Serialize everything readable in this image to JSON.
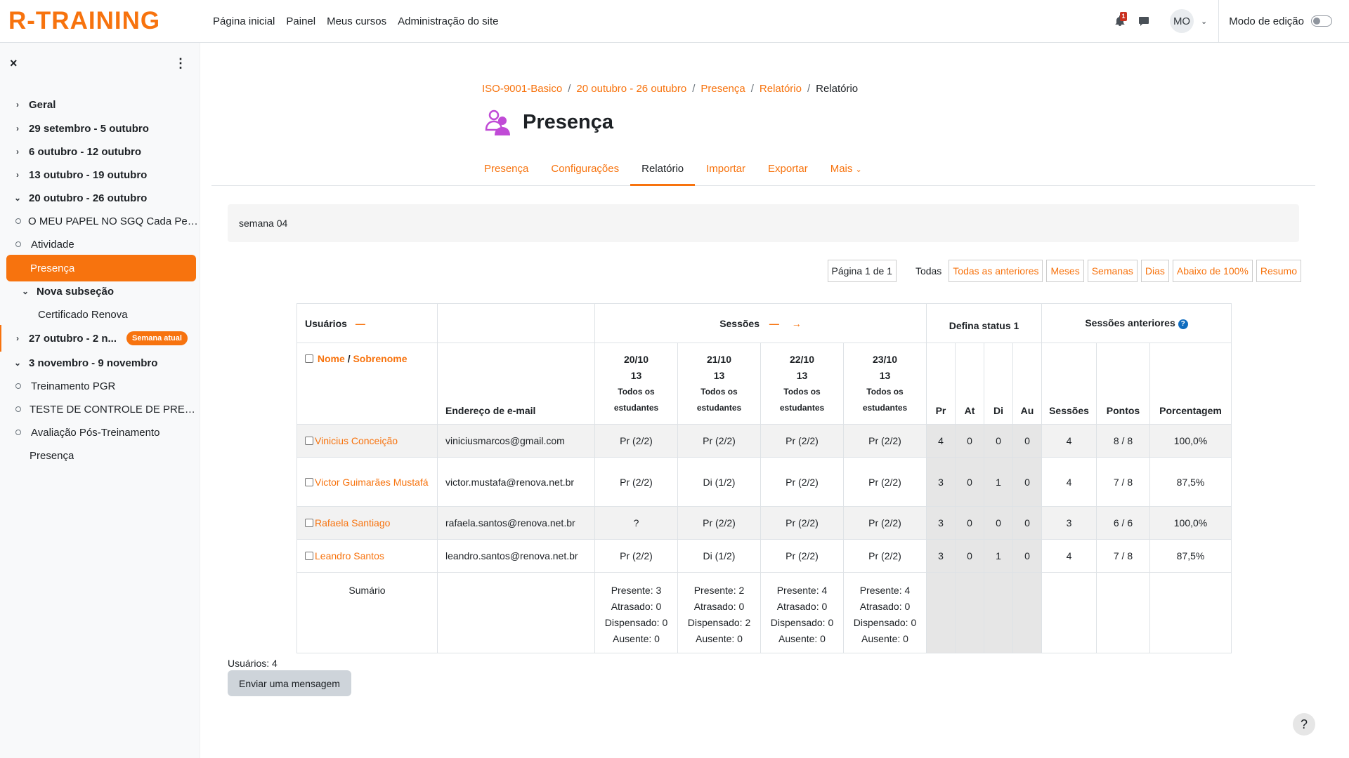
{
  "brand": {
    "logo_text": "R-TRAINING",
    "accent_color": "#f7730e"
  },
  "navbar": {
    "items": [
      "Página inicial",
      "Painel",
      "Meus cursos",
      "Administração do site"
    ],
    "notification_count": "1",
    "avatar_initials": "MO",
    "edit_mode_label": "Modo de edição"
  },
  "drawer": {
    "close_icon": "×",
    "menu_icon": "⋮",
    "items": [
      {
        "label": "Geral"
      },
      {
        "label": "29 setembro - 5 outubro"
      },
      {
        "label": "6 outubro - 12 outubro"
      },
      {
        "label": "13 outubro - 19 outubro"
      },
      {
        "label": "20 outubro - 26 outubro"
      },
      {
        "label": "O MEU PAPEL NO SGQ Cada Pes..."
      },
      {
        "label": "Atividade"
      },
      {
        "label": "Presença"
      },
      {
        "label": "Nova subseção"
      },
      {
        "label": "Certificado Renova"
      },
      {
        "label": "27 outubro - 2 n...",
        "badge": "Semana atual"
      },
      {
        "label": "3 novembro - 9 novembro"
      },
      {
        "label": "Treinamento PGR"
      },
      {
        "label": "TESTE DE CONTROLE DE PRESE..."
      },
      {
        "label": "Avaliação Pós-Treinamento"
      },
      {
        "label": "Presença"
      }
    ]
  },
  "breadcrumb": [
    "ISO-9001-Basico",
    "20 outubro - 26 outubro",
    "Presença",
    "Relatório",
    "Relatório"
  ],
  "page_title": "Presença",
  "tabs": [
    "Presença",
    "Configurações",
    "Relatório",
    "Importar",
    "Exportar",
    "Mais"
  ],
  "description": "semana 04",
  "filters": {
    "page_label": "Página 1 de 1",
    "todas": "Todas",
    "buttons": [
      "Todas as anteriores",
      "Meses",
      "Semanas",
      "Dias",
      "Abaixo de 100%",
      "Resumo"
    ]
  },
  "table": {
    "users_header": "Usuários",
    "sessions_header": "Sessões",
    "status_header": "Defina status 1",
    "previous_header": "Sessões anteriores",
    "name_label": "Nome",
    "surname_label": "Sobrenome",
    "slash": "/",
    "email_header": "Endereço de e-mail",
    "sessions": [
      {
        "date": "20/10",
        "time": "13",
        "group": "Todos os",
        "group2": "estudantes"
      },
      {
        "date": "21/10",
        "time": "13",
        "group": "Todos os",
        "group2": "estudantes"
      },
      {
        "date": "22/10",
        "time": "13",
        "group": "Todos os",
        "group2": "estudantes"
      },
      {
        "date": "23/10",
        "time": "13",
        "group": "Todos os",
        "group2": "estudantes"
      }
    ],
    "status_cols": [
      "Pr",
      "At",
      "Di",
      "Au"
    ],
    "prev_cols": [
      "Sessões",
      "Pontos",
      "Porcentagem"
    ],
    "rows": [
      {
        "name": "Vinicius Conceição",
        "email": "viniciusmarcos@gmail.com",
        "sessions": [
          "Pr (2/2)",
          "Pr (2/2)",
          "Pr (2/2)",
          "Pr (2/2)"
        ],
        "status": [
          "4",
          "0",
          "0",
          "0"
        ],
        "prev": [
          "4",
          "8 / 8",
          "100,0%"
        ]
      },
      {
        "name": "Victor Guimarães Mustafá",
        "email": "victor.mustafa@renova.net.br",
        "sessions": [
          "Pr (2/2)",
          "Di (1/2)",
          "Pr (2/2)",
          "Pr (2/2)"
        ],
        "status": [
          "3",
          "0",
          "1",
          "0"
        ],
        "prev": [
          "4",
          "7 / 8",
          "87,5%"
        ]
      },
      {
        "name": "Rafaela Santiago",
        "email": "rafaela.santos@renova.net.br",
        "sessions": [
          "?",
          "Pr (2/2)",
          "Pr (2/2)",
          "Pr (2/2)"
        ],
        "status": [
          "3",
          "0",
          "0",
          "0"
        ],
        "prev": [
          "3",
          "6 / 6",
          "100,0%"
        ]
      },
      {
        "name": "Leandro Santos",
        "email": "leandro.santos@renova.net.br",
        "sessions": [
          "Pr (2/2)",
          "Di (1/2)",
          "Pr (2/2)",
          "Pr (2/2)"
        ],
        "status": [
          "3",
          "0",
          "1",
          "0"
        ],
        "prev": [
          "4",
          "7 / 8",
          "87,5%"
        ]
      }
    ],
    "summary_label": "Sumário",
    "summary": [
      [
        "Presente: 3",
        "Atrasado: 0",
        "Dispensado: 0",
        "Ausente: 0"
      ],
      [
        "Presente: 2",
        "Atrasado: 0",
        "Dispensado: 2",
        "Ausente: 0"
      ],
      [
        "Presente: 4",
        "Atrasado: 0",
        "Dispensado: 0",
        "Ausente: 0"
      ],
      [
        "Presente: 4",
        "Atrasado: 0",
        "Dispensado: 0",
        "Ausente: 0"
      ]
    ]
  },
  "users_count": "Usuários: 4",
  "send_message_label": "Enviar uma mensagem",
  "help_label": "?"
}
